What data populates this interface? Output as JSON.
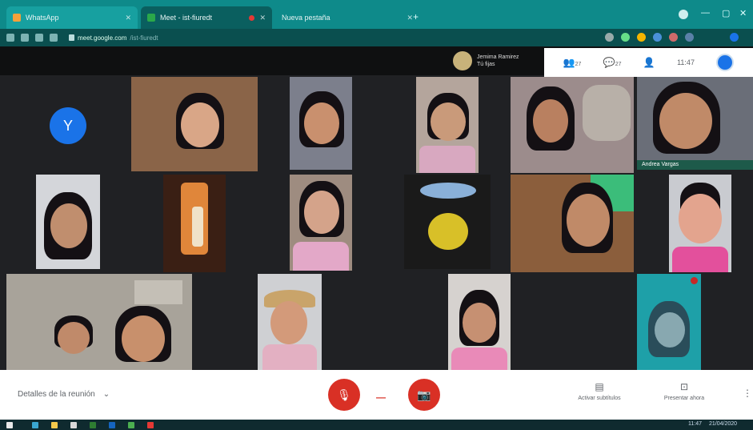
{
  "browser": {
    "tabs": [
      {
        "title": "WhatsApp",
        "active": false,
        "favicon_color": "#f4a13a"
      },
      {
        "title": "Meet - ist-fiuredt",
        "active": true,
        "favicon_color": "#2aa84a"
      },
      {
        "title": "Nueva pestaña",
        "active": false,
        "favicon_color": "#0e8a8a"
      }
    ],
    "new_tab_glyph": "+",
    "url_host": "meet.google.com",
    "url_path": "/ist-fiuredt"
  },
  "meet": {
    "presenter": {
      "name": "Jemima Ramirez",
      "status": "Tú fijas"
    },
    "top_actions": {
      "people_count": "27",
      "chat_count": "27",
      "time": "11:47"
    },
    "me_avatar_color": "#1a73e8",
    "avatar_letter": "Y",
    "pinned_label": "Andrea Vargas",
    "bottom": {
      "details_label": "Detalles de la reunión",
      "details_chevron": "⌄",
      "captions_label": "Activar subtítulos",
      "present_label": "Presentar ahora",
      "hangup_glyph": "—",
      "more_glyph": "⋮"
    }
  },
  "taskbar": {
    "time": "11:47",
    "date": "21/04/2020"
  }
}
